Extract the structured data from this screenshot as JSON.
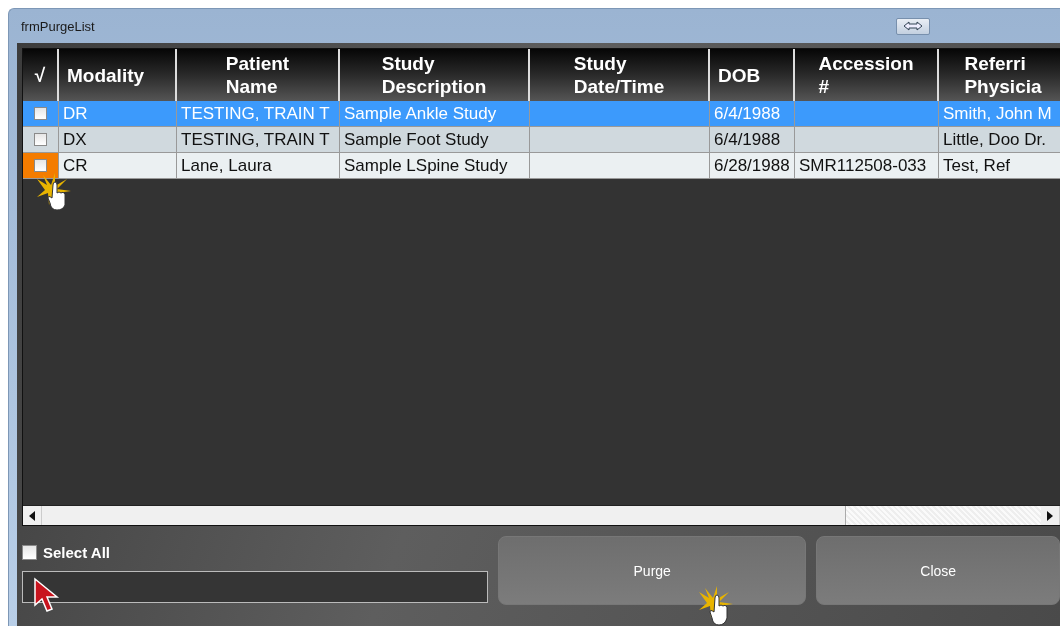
{
  "window": {
    "title": "frmPurgeList"
  },
  "table": {
    "columns": [
      {
        "lines": [
          "√"
        ]
      },
      {
        "lines": [
          "Modality"
        ]
      },
      {
        "lines": [
          "Patient",
          "Name"
        ]
      },
      {
        "lines": [
          "Study",
          "Description"
        ]
      },
      {
        "lines": [
          "Study",
          "Date/Time"
        ]
      },
      {
        "lines": [
          "DOB"
        ]
      },
      {
        "lines": [
          "Accession",
          "#"
        ]
      },
      {
        "lines": [
          "Referri",
          "Physicia"
        ]
      }
    ],
    "rows": [
      {
        "selected": true,
        "checked": false,
        "highlighted": false,
        "cells": [
          "",
          "DR",
          "TESTING, TRAIN T",
          "Sample Ankle Study",
          "",
          "6/4/1988",
          "",
          "Smith, John M"
        ]
      },
      {
        "selected": false,
        "checked": false,
        "highlighted": false,
        "cells": [
          "",
          "DX",
          "TESTING, TRAIN T",
          "Sample Foot Study",
          "",
          "6/4/1988",
          "",
          "Little, Doo Dr."
        ]
      },
      {
        "selected": false,
        "checked": false,
        "highlighted": true,
        "cells": [
          "",
          "CR",
          "Lane, Laura",
          "Sample LSpine Study",
          "",
          "6/28/1988",
          "SMR112508-033",
          "Test, Ref"
        ]
      }
    ]
  },
  "select_all": {
    "label": "Select All",
    "checked": false
  },
  "buttons": [
    {
      "label": "Purge"
    },
    {
      "label": "Close"
    }
  ]
}
